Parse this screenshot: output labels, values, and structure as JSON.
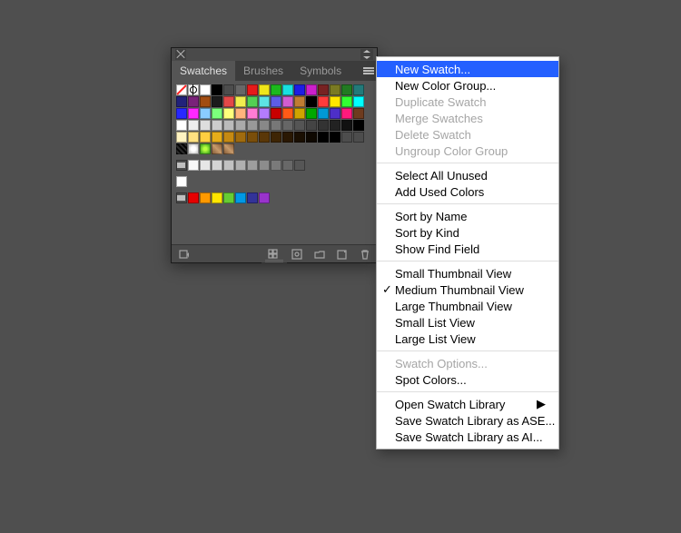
{
  "panel": {
    "tabs": [
      {
        "label": "Swatches",
        "active": true
      },
      {
        "label": "Brushes",
        "active": false
      },
      {
        "label": "Symbols",
        "active": false
      }
    ],
    "footer_icons": [
      "library",
      "new-group",
      "new-swatch",
      "color-group",
      "link",
      "trash"
    ],
    "swatch_rows": [
      [
        {
          "special": "none"
        },
        {
          "special": "reg"
        },
        {
          "c": "#ffffff"
        },
        {
          "c": "#000000"
        },
        {
          "c": "#4d4d4d"
        },
        {
          "c": "#676767"
        },
        {
          "c": "#e61a1a"
        },
        {
          "c": "#f0e619"
        },
        {
          "c": "#1cb91c"
        },
        {
          "c": "#18e0e0"
        },
        {
          "c": "#1d1de6"
        },
        {
          "c": "#cc1fcc"
        },
        {
          "c": "#772222"
        },
        {
          "c": "#7a7a22"
        },
        {
          "c": "#227a22"
        },
        {
          "c": "#227a7a"
        }
      ],
      [
        {
          "c": "#22227a"
        },
        {
          "c": "#7a227a"
        },
        {
          "c": "#a24d12"
        },
        {
          "c": "#1b1b1b"
        },
        {
          "c": "#e34848"
        },
        {
          "c": "#f0ed4f"
        },
        {
          "c": "#53d053"
        },
        {
          "c": "#5de3e3"
        },
        {
          "c": "#5d5de6"
        },
        {
          "c": "#d15dd1"
        },
        {
          "c": "#c07d33"
        },
        {
          "c": "#000000"
        },
        {
          "c": "#ff3b3b"
        },
        {
          "c": "#ffe600"
        },
        {
          "c": "#32ff32"
        },
        {
          "c": "#00ffff"
        }
      ],
      [
        {
          "c": "#2828ff"
        },
        {
          "c": "#ff28ff"
        },
        {
          "c": "#8accff"
        },
        {
          "c": "#7cff7c"
        },
        {
          "c": "#ffff7c"
        },
        {
          "c": "#ffb47c"
        },
        {
          "c": "#ff7cd4"
        },
        {
          "c": "#b47cff"
        },
        {
          "c": "#c80000"
        },
        {
          "c": "#ff5a17"
        },
        {
          "c": "#d0a400"
        },
        {
          "c": "#00a800"
        },
        {
          "c": "#0099d4"
        },
        {
          "c": "#4d2fc8"
        },
        {
          "c": "#ff1a7c"
        },
        {
          "c": "#6e3b1e"
        }
      ],
      [
        {
          "c": "#ffffff"
        },
        {
          "c": "#eeeeee"
        },
        {
          "c": "#dddddd"
        },
        {
          "c": "#cccccc"
        },
        {
          "c": "#bbbbbb"
        },
        {
          "c": "#aaaaaa"
        },
        {
          "c": "#999999"
        },
        {
          "c": "#888888"
        },
        {
          "c": "#777777"
        },
        {
          "c": "#666666"
        },
        {
          "c": "#555555"
        },
        {
          "c": "#444444"
        },
        {
          "c": "#333333"
        },
        {
          "c": "#222222"
        },
        {
          "c": "#111111"
        },
        {
          "c": "#000000"
        }
      ],
      [
        {
          "c": "#fff3c0"
        },
        {
          "c": "#ffe180"
        },
        {
          "c": "#ffcf40"
        },
        {
          "c": "#e6ad1a"
        },
        {
          "c": "#c68a12"
        },
        {
          "c": "#a06b0e"
        },
        {
          "c": "#7a4e0a"
        },
        {
          "c": "#5a3708"
        },
        {
          "c": "#3e2505"
        },
        {
          "c": "#2a1803"
        },
        {
          "c": "#1a0f02"
        },
        {
          "c": "#0e0801"
        },
        {
          "c": "#000000"
        },
        {
          "c": "#000000"
        },
        {
          "c": "#4d4d4d"
        },
        {
          "c": "#4d4d4d"
        }
      ],
      [
        {
          "special": "pat"
        },
        {
          "special": "pat2"
        },
        {
          "special": "pat3"
        },
        {
          "special": "pat4"
        },
        {
          "special": "pat4"
        }
      ]
    ],
    "gray_row": [
      "#f8f8f8",
      "#e6e6e6",
      "#d4d4d4",
      "#c2c2c2",
      "#b0b0b0",
      "#9e9e9e",
      "#8c8c8c",
      "#7a7a7a",
      "#686868",
      "#565656"
    ],
    "white_row": [
      "#ffffff"
    ],
    "color_group_row": [
      "#e60000",
      "#ff9900",
      "#ffe600",
      "#66cc33",
      "#0099e6",
      "#333399",
      "#9933cc"
    ]
  },
  "menu": {
    "groups": [
      [
        {
          "label": "New Swatch...",
          "enabled": true,
          "selected": true
        },
        {
          "label": "New Color Group...",
          "enabled": true
        },
        {
          "label": "Duplicate Swatch",
          "enabled": false
        },
        {
          "label": "Merge Swatches",
          "enabled": false
        },
        {
          "label": "Delete Swatch",
          "enabled": false
        },
        {
          "label": "Ungroup Color Group",
          "enabled": false
        }
      ],
      [
        {
          "label": "Select All Unused",
          "enabled": true
        },
        {
          "label": "Add Used Colors",
          "enabled": true
        }
      ],
      [
        {
          "label": "Sort by Name",
          "enabled": true
        },
        {
          "label": "Sort by Kind",
          "enabled": true
        },
        {
          "label": "Show Find Field",
          "enabled": true
        }
      ],
      [
        {
          "label": "Small Thumbnail View",
          "enabled": true
        },
        {
          "label": "Medium Thumbnail View",
          "enabled": true,
          "checked": true
        },
        {
          "label": "Large Thumbnail View",
          "enabled": true
        },
        {
          "label": "Small List View",
          "enabled": true
        },
        {
          "label": "Large List View",
          "enabled": true
        }
      ],
      [
        {
          "label": "Swatch Options...",
          "enabled": false
        },
        {
          "label": "Spot Colors...",
          "enabled": true
        }
      ],
      [
        {
          "label": "Open Swatch Library",
          "enabled": true,
          "submenu": true
        },
        {
          "label": "Save Swatch Library as ASE...",
          "enabled": true
        },
        {
          "label": "Save Swatch Library as AI...",
          "enabled": true
        }
      ]
    ]
  }
}
